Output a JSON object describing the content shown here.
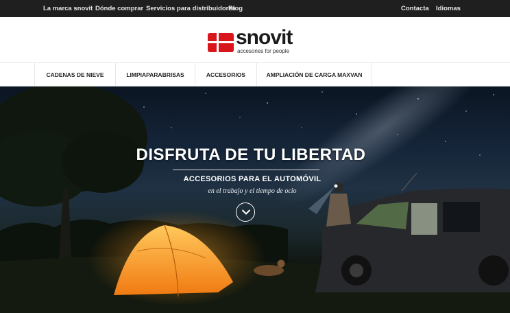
{
  "topbar": {
    "left_links": [
      "La marca snovit",
      "Dónde comprar",
      "Servicios para distribuidores",
      "Blog"
    ],
    "right_links": [
      "Contacta",
      "Idiomas"
    ]
  },
  "logo": {
    "word": "snovit",
    "tagline": "accesories for people",
    "brand_color": "#d8161c"
  },
  "nav": {
    "items": [
      "CADENAS DE NIEVE",
      "LIMPIAPARABRISAS",
      "ACCESORIOS",
      "AMPLIACIÓN DE CARGA MAXVAN"
    ]
  },
  "hero": {
    "title": "DISFRUTA DE TU LIBERTAD",
    "subtitle": "ACCESORIOS PARA EL AUTOMÓVIL",
    "tagline": "en el trabajo y el tiempo de ocio",
    "scroll_icon": "chevron-down-icon"
  }
}
